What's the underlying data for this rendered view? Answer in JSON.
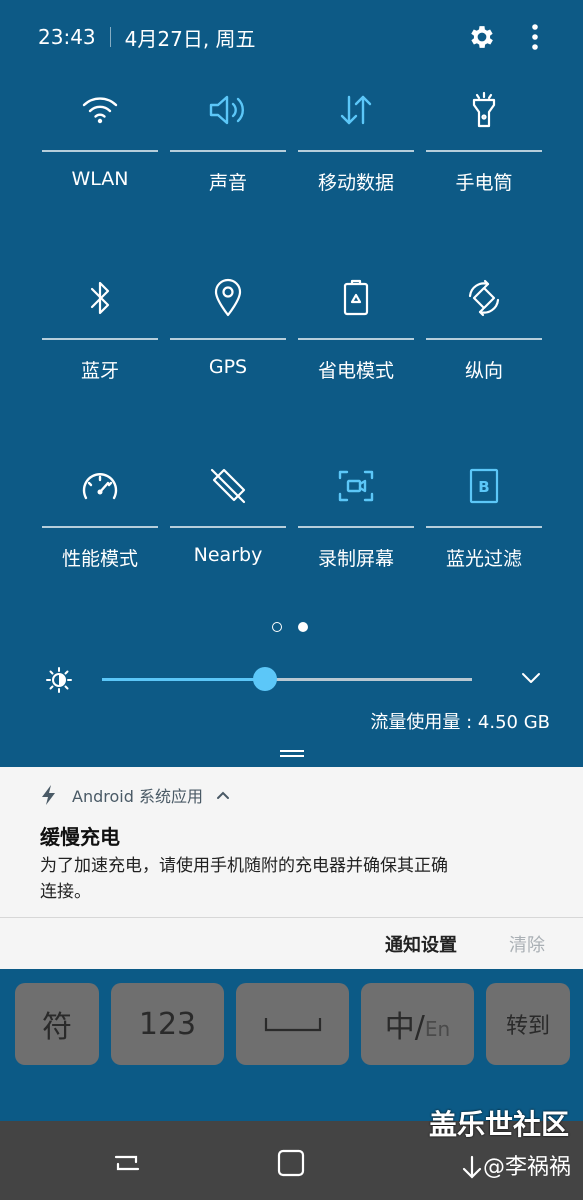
{
  "status": {
    "time": "23:43",
    "date": "4月27日, 周五"
  },
  "tiles": [
    {
      "label": "WLAN",
      "icon": "wifi-icon",
      "active": false
    },
    {
      "label": "声音",
      "icon": "volume-icon",
      "active": true
    },
    {
      "label": "移动数据",
      "icon": "mobile-data-icon",
      "active": true
    },
    {
      "label": "手电筒",
      "icon": "flashlight-icon",
      "active": false
    },
    {
      "label": "蓝牙",
      "icon": "bluetooth-icon",
      "active": false
    },
    {
      "label": "GPS",
      "icon": "location-icon",
      "active": false
    },
    {
      "label": "省电模式",
      "icon": "battery-saver-icon",
      "active": false
    },
    {
      "label": "纵向",
      "icon": "rotation-icon",
      "active": false
    },
    {
      "label": "性能模式",
      "icon": "performance-icon",
      "active": false
    },
    {
      "label": "Nearby",
      "icon": "nearby-icon",
      "active": false
    },
    {
      "label": "录制屏幕",
      "icon": "screen-record-icon",
      "active": true
    },
    {
      "label": "蓝光过滤",
      "icon": "blue-light-filter-icon",
      "active": true
    }
  ],
  "page_dots": {
    "count": 2,
    "current": 2
  },
  "brightness": {
    "level": 0.44
  },
  "data_usage": "流量使用量 : 4.50 GB",
  "notification": {
    "app": "Android 系统应用",
    "title": "缓慢充电",
    "body": "为了加速充电，请使用手机随附的充电器并确保其正确连接。",
    "settings_button": "通知设置",
    "clear_button": "清除"
  },
  "keyboard": {
    "keys": [
      "符",
      "123",
      "",
      "中/",
      "转到"
    ],
    "lang_suffix": "En"
  },
  "watermark": "盖乐世社区",
  "weibo": "@李祸祸",
  "colors": {
    "accent": "#5cc7f8",
    "panel": "#0d5a86",
    "inactive": "#ffffff"
  }
}
